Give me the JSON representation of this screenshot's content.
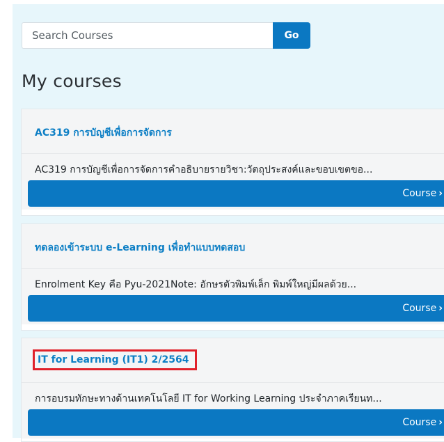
{
  "search": {
    "placeholder": "Search Courses",
    "button_label": "Go"
  },
  "page": {
    "title": "My courses"
  },
  "courses": [
    {
      "title": "AC319 การบัญชีเพื่อการจัดการ",
      "summary": "AC319 การบัญชีเพื่อการจัดการคำอธิบายรายวิชา:วัตถุประสงค์และขอบเขตขอ...",
      "button_label": "Course",
      "button_chevron": "›"
    },
    {
      "title": "ทดลองเข้าระบบ e-Learning เพื่อทำแบบทดสอบ",
      "summary": "Enrolment Key คือ Pyu-2021Note: อักษรตัวพิมพ์เล็ก พิมพ์ใหญ่มีผลด้วย...",
      "button_label": "Course",
      "button_chevron": "›"
    },
    {
      "title": "IT for Learning (IT1) 2/2564",
      "summary": "การอบรมทักษะทางด้านเทคโนโลยี IT for Working Learning ประจำภาคเรียนท...",
      "button_label": "Course",
      "button_chevron": "›"
    }
  ],
  "colors": {
    "accent": "#0b78c2",
    "link": "#0d7fc5",
    "highlight_box": "#e0212a",
    "panel_bg": "#e7f6fb"
  }
}
